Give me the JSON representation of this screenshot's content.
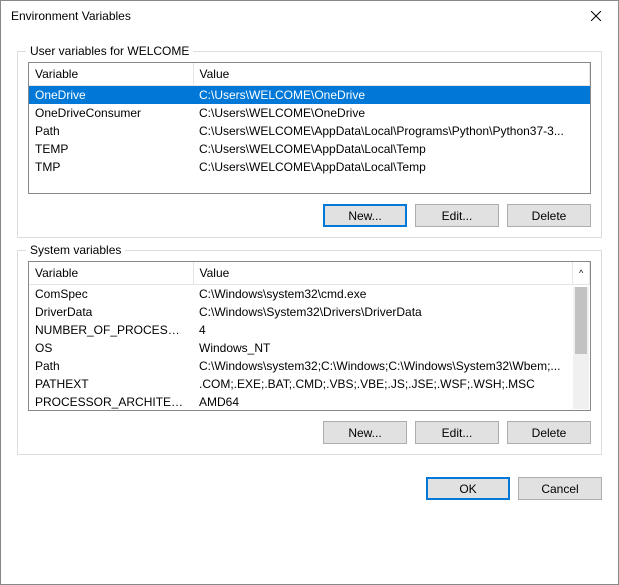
{
  "window": {
    "title": "Environment Variables"
  },
  "userSection": {
    "label": "User variables for WELCOME",
    "headers": {
      "var": "Variable",
      "val": "Value"
    },
    "rows": [
      {
        "var": "OneDrive",
        "val": "C:\\Users\\WELCOME\\OneDrive",
        "selected": true
      },
      {
        "var": "OneDriveConsumer",
        "val": "C:\\Users\\WELCOME\\OneDrive"
      },
      {
        "var": "Path",
        "val": "C:\\Users\\WELCOME\\AppData\\Local\\Programs\\Python\\Python37-3..."
      },
      {
        "var": "TEMP",
        "val": "C:\\Users\\WELCOME\\AppData\\Local\\Temp"
      },
      {
        "var": "TMP",
        "val": "C:\\Users\\WELCOME\\AppData\\Local\\Temp"
      }
    ],
    "buttons": {
      "new": "New...",
      "edit": "Edit...",
      "delete": "Delete"
    }
  },
  "systemSection": {
    "label": "System variables",
    "headers": {
      "var": "Variable",
      "val": "Value"
    },
    "rows": [
      {
        "var": "ComSpec",
        "val": "C:\\Windows\\system32\\cmd.exe"
      },
      {
        "var": "DriverData",
        "val": "C:\\Windows\\System32\\Drivers\\DriverData"
      },
      {
        "var": "NUMBER_OF_PROCESSORS",
        "val": "4"
      },
      {
        "var": "OS",
        "val": "Windows_NT"
      },
      {
        "var": "Path",
        "val": "C:\\Windows\\system32;C:\\Windows;C:\\Windows\\System32\\Wbem;..."
      },
      {
        "var": "PATHEXT",
        "val": ".COM;.EXE;.BAT;.CMD;.VBS;.VBE;.JS;.JSE;.WSF;.WSH;.MSC"
      },
      {
        "var": "PROCESSOR_ARCHITECTURE",
        "val": "AMD64"
      }
    ],
    "buttons": {
      "new": "New...",
      "edit": "Edit...",
      "delete": "Delete"
    }
  },
  "dialogButtons": {
    "ok": "OK",
    "cancel": "Cancel"
  }
}
